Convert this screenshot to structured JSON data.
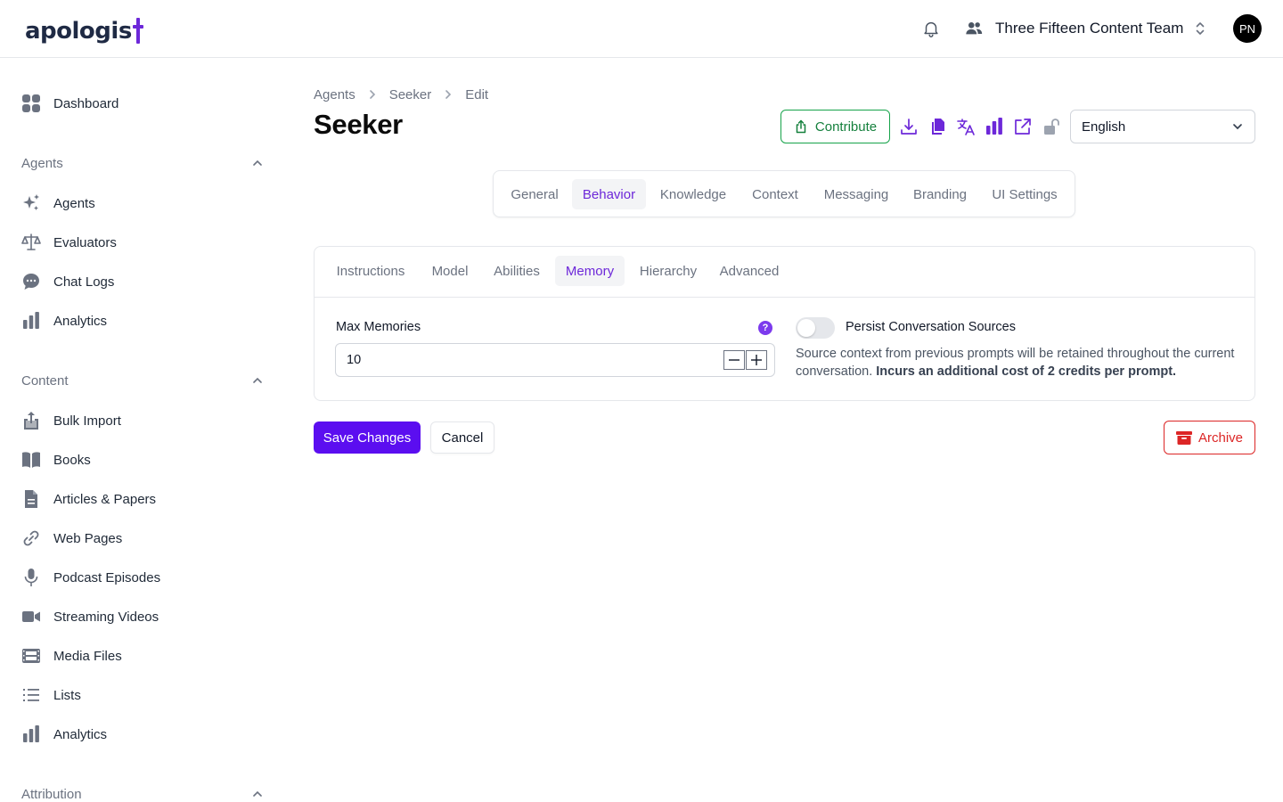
{
  "brand": {
    "logo_text": "apologis",
    "accent": "#6d28d9"
  },
  "header": {
    "team_name": "Three Fifteen Content Team",
    "avatar_initials": "PN"
  },
  "sidebar": {
    "dashboard": "Dashboard",
    "sections": [
      {
        "title": "Agents",
        "items": [
          "Agents",
          "Evaluators",
          "Chat Logs",
          "Analytics"
        ]
      },
      {
        "title": "Content",
        "items": [
          "Bulk Import",
          "Books",
          "Articles & Papers",
          "Web Pages",
          "Podcast Episodes",
          "Streaming Videos",
          "Media Files",
          "Lists",
          "Analytics"
        ]
      },
      {
        "title": "Attribution",
        "items": []
      }
    ]
  },
  "breadcrumb": [
    "Agents",
    "Seeker",
    "Edit"
  ],
  "page_title": "Seeker",
  "toolbar": {
    "contribute_label": "Contribute",
    "icons": [
      "download-icon",
      "copy-icon",
      "translate-icon",
      "analytics-icon",
      "external-link-icon",
      "unlock-icon"
    ],
    "language": "English"
  },
  "tabs": [
    "General",
    "Behavior",
    "Knowledge",
    "Context",
    "Messaging",
    "Branding",
    "UI Settings"
  ],
  "active_tab": "Behavior",
  "subtabs": [
    "Instructions",
    "Model",
    "Abilities",
    "Memory",
    "Hierarchy",
    "Advanced"
  ],
  "active_subtab": "Memory",
  "memory": {
    "max_memories_label": "Max Memories",
    "max_memories_value": "10",
    "help": "?",
    "persist_label": "Persist Conversation Sources",
    "persist_enabled": false,
    "persist_desc": "Source context from previous prompts will be retained throughout the current conversation.",
    "persist_desc_bold": "Incurs an additional cost of 2 credits per prompt."
  },
  "actions": {
    "save": "Save Changes",
    "cancel": "Cancel",
    "archive": "Archive"
  },
  "colors": {
    "primary": "#5b0ef0",
    "success": "#16a34a",
    "danger": "#dc2626"
  }
}
